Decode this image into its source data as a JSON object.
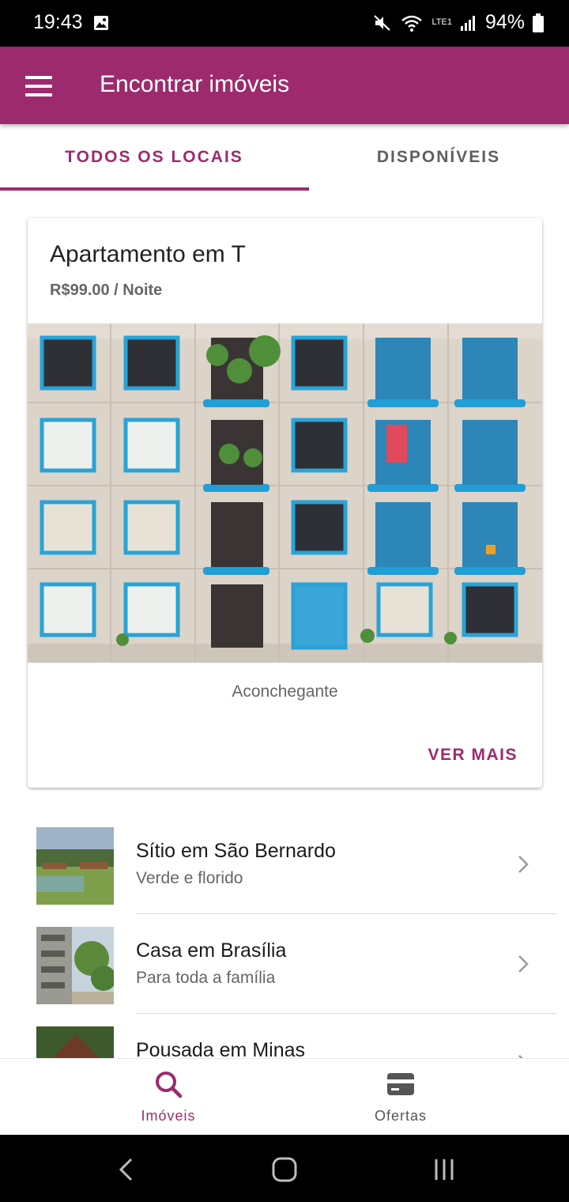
{
  "status_bar": {
    "time": "19:43",
    "battery": "94%",
    "network": "LTE1"
  },
  "app_bar": {
    "title": "Encontrar imóveis"
  },
  "tabs": [
    {
      "label": "TODOS OS LOCAIS",
      "selected": true
    },
    {
      "label": "DISPONÍVEIS",
      "selected": false
    }
  ],
  "featured": {
    "title": "Apartamento em T",
    "price": "R$99.00 / Noite",
    "description": "Aconchegante",
    "action": "VER MAIS"
  },
  "listings": [
    {
      "title": "Sítio em São Bernardo",
      "subtitle": "Verde e florido"
    },
    {
      "title": "Casa em Brasília",
      "subtitle": "Para toda a família"
    },
    {
      "title": "Pousada em Minas",
      "subtitle": ""
    }
  ],
  "bottom_nav": [
    {
      "label": "Imóveis",
      "icon": "search-icon",
      "selected": true
    },
    {
      "label": "Ofertas",
      "icon": "card-icon",
      "selected": false
    }
  ],
  "colors": {
    "primary": "#9e2a6e",
    "text_secondary": "#666666"
  }
}
